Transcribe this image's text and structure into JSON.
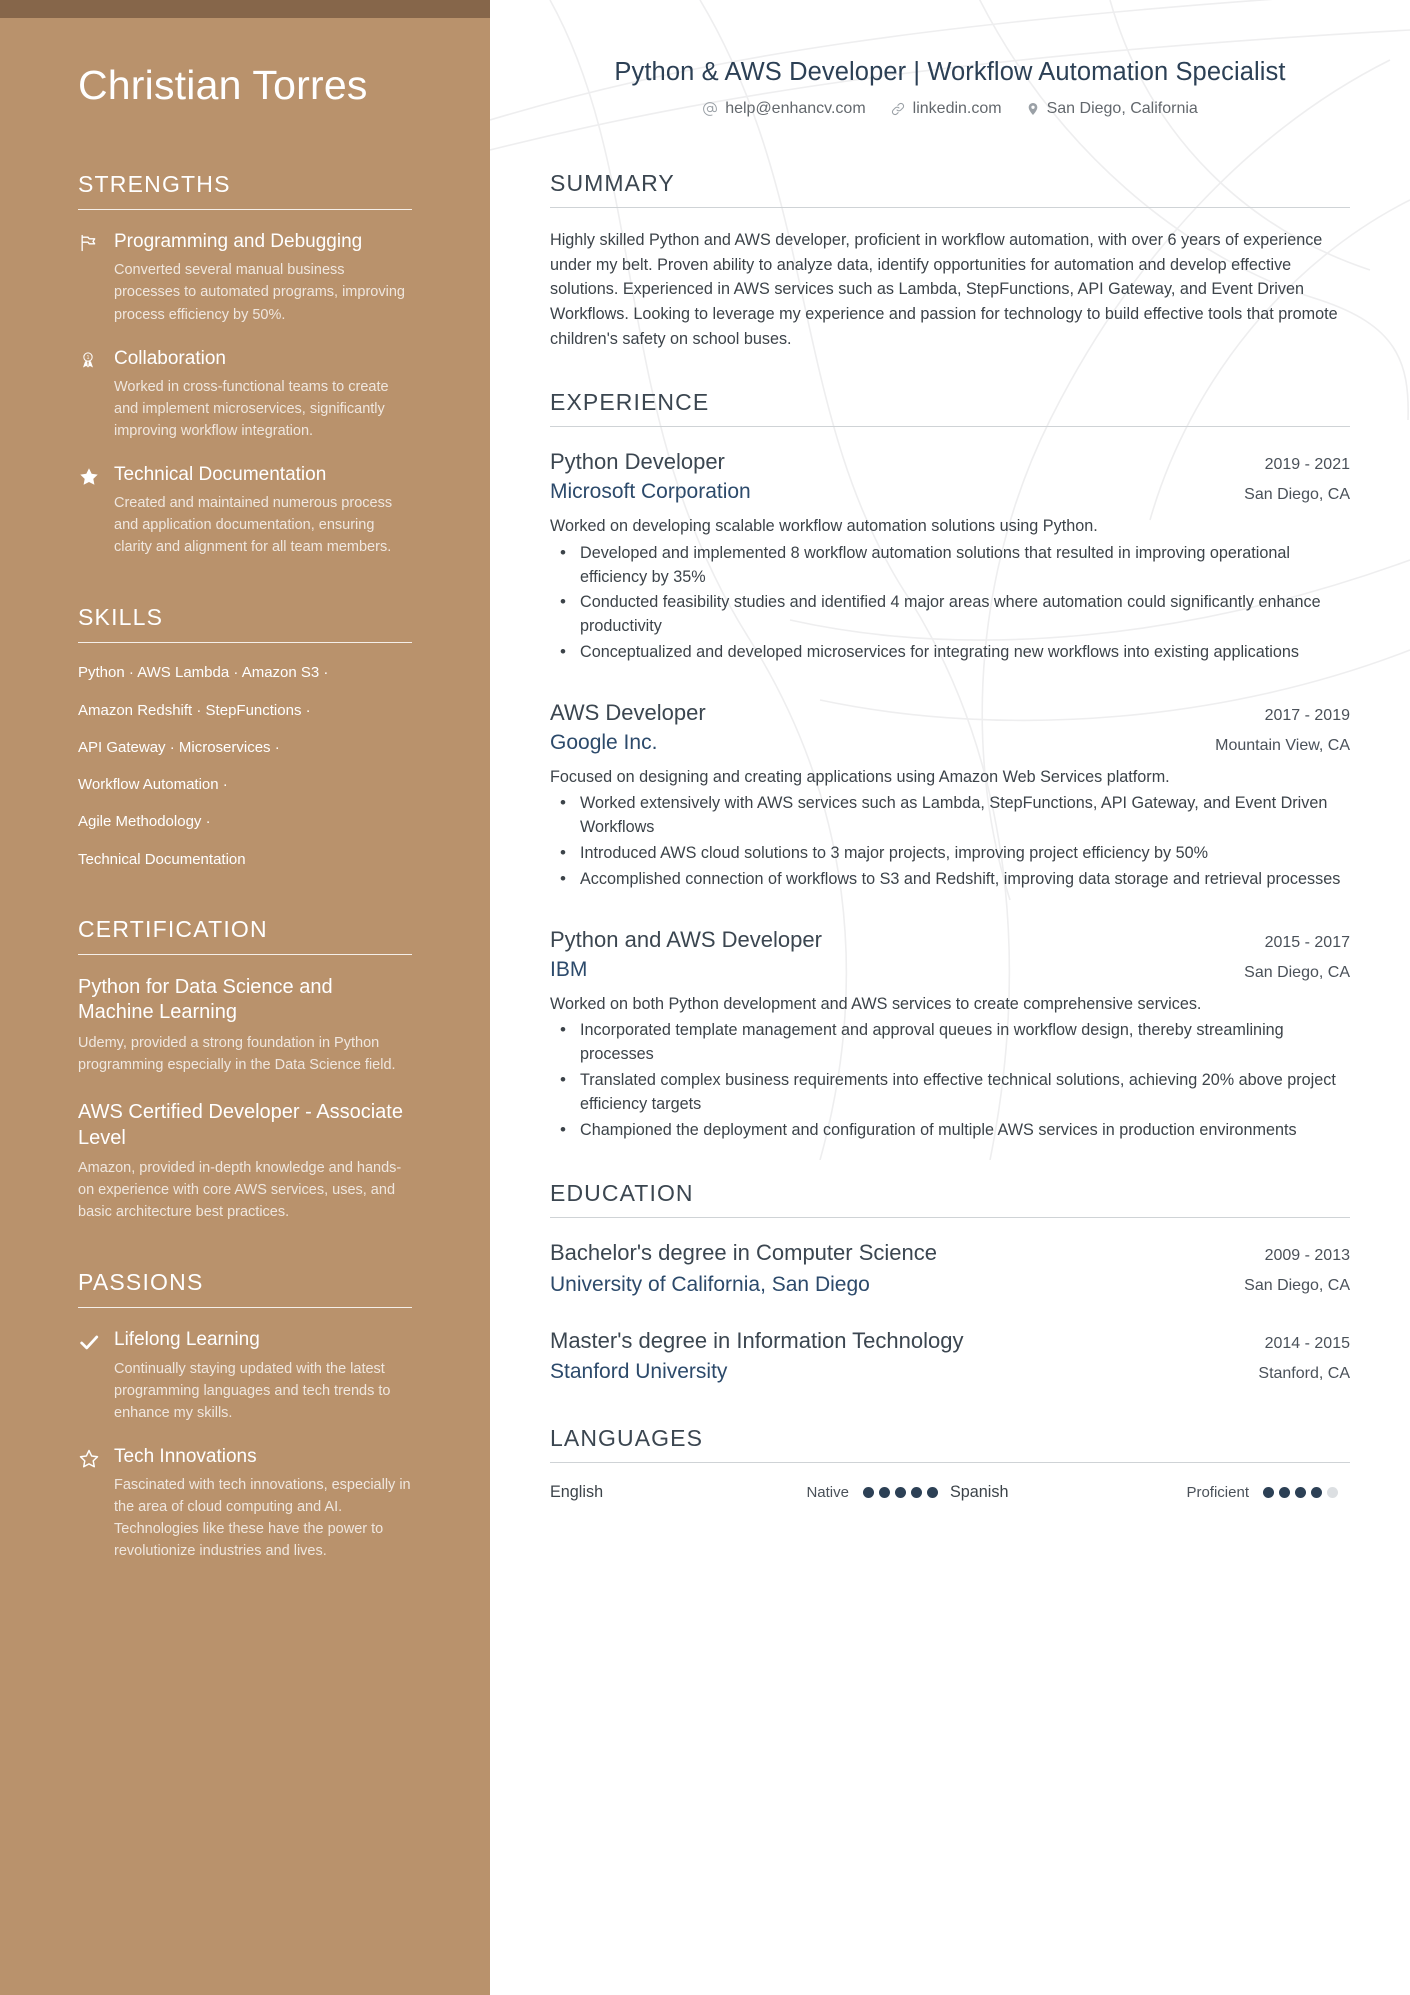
{
  "colors": {
    "sidebar_bg": "#b9926c",
    "sidebar_topbar": "#86664a",
    "accent_navy": "#2c4a6b",
    "heading_gray": "#3b4650",
    "body_text": "#3c4349"
  },
  "sidebar": {
    "name": "Christian Torres",
    "sections": [
      {
        "title": "STRENGTHS",
        "type": "entries",
        "items": [
          {
            "icon": "flag-icon",
            "title": "Programming and Debugging",
            "description": "Converted several manual business processes to automated programs, improving process efficiency by 50%."
          },
          {
            "icon": "award-icon",
            "title": "Collaboration",
            "description": "Worked in cross-functional teams to create and implement microservices, significantly improving workflow integration."
          },
          {
            "icon": "star-filled-icon",
            "title": "Technical Documentation",
            "description": "Created and maintained numerous process and application documentation, ensuring clarity and alignment for all team members."
          }
        ]
      },
      {
        "title": "SKILLS",
        "type": "skills",
        "lines": [
          "Python · AWS Lambda · Amazon S3 ·",
          "Amazon Redshift · StepFunctions ·",
          "API Gateway · Microservices ·",
          "Workflow Automation ·",
          "Agile Methodology ·",
          "Technical Documentation"
        ]
      },
      {
        "title": "CERTIFICATION",
        "type": "certs",
        "items": [
          {
            "title": "Python for Data Science and Machine Learning",
            "description": "Udemy, provided a strong foundation in Python programming especially in the Data Science field."
          },
          {
            "title": "AWS Certified Developer - Associate Level",
            "description": "Amazon, provided in-depth knowledge and hands-on experience with core AWS services, uses, and basic architecture best practices."
          }
        ]
      },
      {
        "title": "PASSIONS",
        "type": "entries",
        "items": [
          {
            "icon": "check-icon",
            "title": "Lifelong Learning",
            "description": "Continually staying updated with the latest programming languages and tech trends to enhance my skills."
          },
          {
            "icon": "star-outline-icon",
            "title": "Tech Innovations",
            "description": "Fascinated with tech innovations, especially in the area of cloud computing and AI. Technologies like these have the power to revolutionize industries and lives."
          }
        ]
      }
    ]
  },
  "main": {
    "headline": "Python & AWS Developer | Workflow Automation Specialist",
    "contacts": [
      {
        "icon": "at-icon",
        "text": "help@enhancv.com"
      },
      {
        "icon": "link-icon",
        "text": "linkedin.com"
      },
      {
        "icon": "location-pin-icon",
        "text": "San Diego, California"
      }
    ],
    "summary": {
      "title": "SUMMARY",
      "text": "Highly skilled Python and AWS developer, proficient in workflow automation, with over 6 years of experience under my belt. Proven ability to analyze data, identify opportunities for automation and develop effective solutions. Experienced in AWS services such as Lambda, StepFunctions, API Gateway, and Event Driven Workflows. Looking to leverage my experience and passion for technology to build effective tools that promote children's safety on school buses."
    },
    "experience": {
      "title": "EXPERIENCE",
      "jobs": [
        {
          "title": "Python Developer",
          "company": "Microsoft Corporation",
          "dates": "2019 - 2021",
          "location": "San Diego, CA",
          "summary": "Worked on developing scalable workflow automation solutions using Python.",
          "bullets": [
            "Developed and implemented 8 workflow automation solutions that resulted in improving operational efficiency by 35%",
            "Conducted feasibility studies and identified 4 major areas where automation could significantly enhance productivity",
            "Conceptualized and developed microservices for integrating new workflows into existing applications"
          ]
        },
        {
          "title": "AWS Developer",
          "company": "Google Inc.",
          "dates": "2017 - 2019",
          "location": "Mountain View, CA",
          "summary": "Focused on designing and creating applications using Amazon Web Services platform.",
          "bullets": [
            "Worked extensively with AWS services such as Lambda, StepFunctions, API Gateway, and Event Driven Workflows",
            "Introduced AWS cloud solutions to 3 major projects, improving project efficiency by 50%",
            "Accomplished connection of workflows to S3 and Redshift, improving data storage and retrieval processes"
          ]
        },
        {
          "title": "Python and AWS Developer",
          "company": "IBM",
          "dates": "2015 - 2017",
          "location": "San Diego, CA",
          "summary": "Worked on both Python development and AWS services to create comprehensive services.",
          "bullets": [
            "Incorporated template management and approval queues in workflow design, thereby streamlining processes",
            "Translated complex business requirements into effective technical solutions, achieving 20% above project efficiency targets",
            "Championed the deployment and configuration of multiple AWS services in production environments"
          ]
        }
      ]
    },
    "education": {
      "title": "EDUCATION",
      "items": [
        {
          "degree": "Bachelor's degree in Computer Science",
          "school": "University of California, San Diego",
          "dates": "2009 - 2013",
          "location": "San Diego, CA"
        },
        {
          "degree": "Master's degree in Information Technology",
          "school": "Stanford University",
          "dates": "2014 - 2015",
          "location": "Stanford, CA"
        }
      ]
    },
    "languages": {
      "title": "LANGUAGES",
      "items": [
        {
          "name": "English",
          "level": "Native",
          "filled": 5,
          "total": 5
        },
        {
          "name": "Spanish",
          "level": "Proficient",
          "filled": 4,
          "total": 5
        }
      ]
    }
  }
}
